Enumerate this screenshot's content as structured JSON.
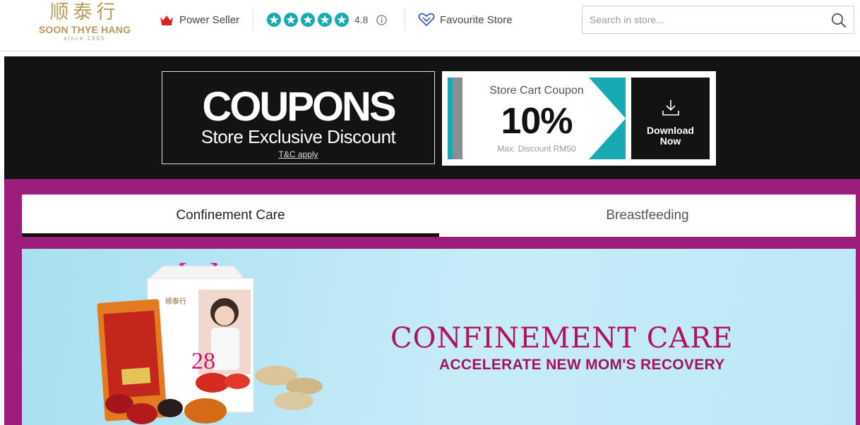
{
  "header": {
    "logo": {
      "chinese": "顺泰行",
      "name": "SOON THYE HANG",
      "since": "since 1965"
    },
    "power_seller": "Power Seller",
    "rating": {
      "value": "4.8",
      "stars": 5
    },
    "favourite_store": "Favourite Store",
    "search": {
      "placeholder": "Search in store...",
      "value": ""
    }
  },
  "banner": {
    "coupons_title": "COUPONS",
    "coupons_subtitle": "Store Exclusive Discount",
    "tnc": "T&C apply",
    "coupon": {
      "label": "Store Cart Coupon",
      "value": "10%",
      "max_discount": "Max. Discount RM50",
      "download_line1": "Download",
      "download_line2": "Now"
    }
  },
  "tabs": [
    {
      "label": "Confinement Care",
      "active": true
    },
    {
      "label": "Breastfeeding",
      "active": false
    }
  ],
  "hero": {
    "title": "CONFINEMENT CARE",
    "subtitle": "ACCELERATE NEW MOM'S RECOVERY",
    "product_box_text": "顺泰行",
    "product_box_number": "28"
  },
  "colors": {
    "brand_gold": "#b99a5c",
    "teal": "#17aab3",
    "purple": "#9d1d7d",
    "banner_black": "#131313",
    "hero_magenta": "#b0125e"
  }
}
